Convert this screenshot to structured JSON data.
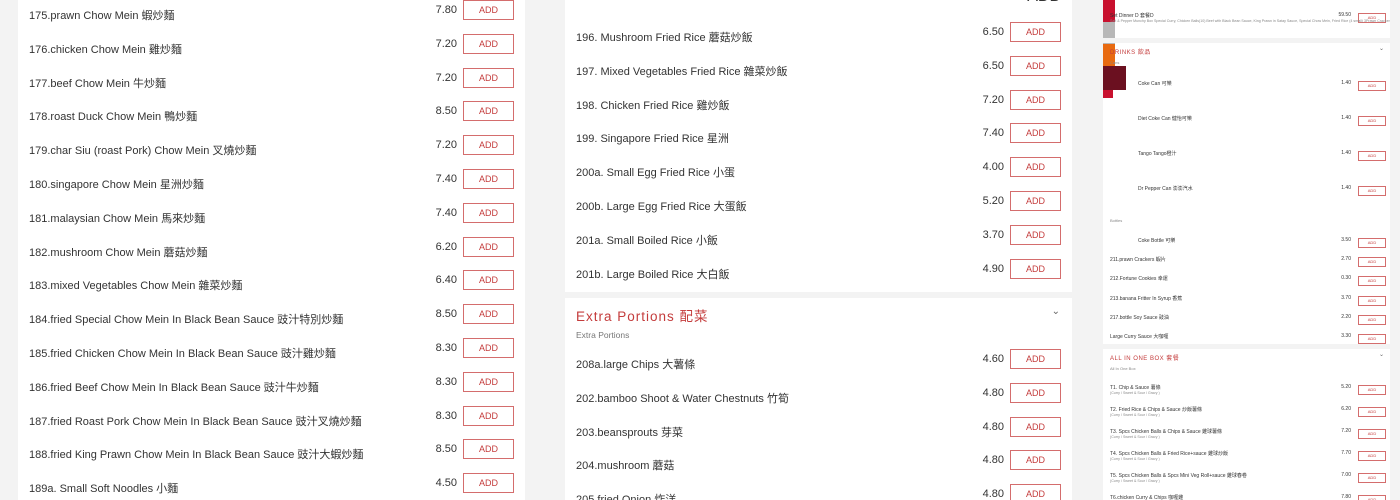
{
  "add_label": "ADD",
  "accent_color": "#c43c3c",
  "chow_mein": [
    {
      "name": "175.prawn Chow Mein 蝦炒麵",
      "price": "7.80"
    },
    {
      "name": "176.chicken Chow Mein 雞炒麵",
      "price": "7.20"
    },
    {
      "name": "177.beef Chow Mein 牛炒麵",
      "price": "7.20"
    },
    {
      "name": "178.roast Duck Chow Mein 鴨炒麵",
      "price": "8.50"
    },
    {
      "name": "179.char Siu (roast Pork) Chow Mein 叉燒炒麵",
      "price": "7.20"
    },
    {
      "name": "180.singapore Chow Mein 星洲炒麵",
      "price": "7.40"
    },
    {
      "name": "181.malaysian Chow Mein 馬來炒麵",
      "price": "7.40"
    },
    {
      "name": "182.mushroom Chow Mein 蘑菇炒麵",
      "price": "6.20"
    },
    {
      "name": "183.mixed Vegetables Chow Mein 雜菜炒麵",
      "price": "6.40"
    },
    {
      "name": "184.fried Special Chow Mein In Black Bean Sauce 豉汁特別炒麵",
      "price": "8.50"
    },
    {
      "name": "185.fried Chicken Chow Mein In Black Bean Sauce 豉汁雞炒麵",
      "price": "8.30"
    },
    {
      "name": "186.fried Beef Chow Mein In Black Bean Sauce 豉汁牛炒麵",
      "price": "8.30"
    },
    {
      "name": "187.fried Roast Pork Chow Mein In Black Bean Sauce 豉汁叉燒炒麵",
      "price": "8.30"
    },
    {
      "name": "188.fried King Prawn Chow Mein In Black Bean Sauce 豉汁大蝦炒麵",
      "price": "8.50"
    },
    {
      "name": "189a. Small Soft Noodles 小麵",
      "price": "4.50"
    }
  ],
  "fried_rice": [
    {
      "name": "196. Mushroom Fried Rice 蘑菇炒飯",
      "price": "6.50"
    },
    {
      "name": "197. Mixed Vegetables Fried Rice 雜菜炒飯",
      "price": "6.50"
    },
    {
      "name": "198. Chicken Fried Rice 雞炒飯",
      "price": "7.20"
    },
    {
      "name": "199. Singapore Fried Rice 星洲",
      "price": "7.40"
    },
    {
      "name": "200a. Small Egg Fried Rice 小蛋",
      "price": "4.00"
    },
    {
      "name": "200b. Large Egg Fried Rice 大蛋飯",
      "price": "5.20"
    },
    {
      "name": "201a. Small Boiled Rice 小飯",
      "price": "3.70"
    },
    {
      "name": "201b. Large Boiled Rice 大白飯",
      "price": "4.90"
    }
  ],
  "extra_portions": {
    "title": "Extra Portions 配菜",
    "subtitle": "Extra Portions",
    "items": [
      {
        "name": "208a.large Chips 大薯條",
        "price": "4.60"
      },
      {
        "name": "202.bamboo Shoot & Water Chestnuts 竹筍",
        "price": "4.80"
      },
      {
        "name": "203.beansprouts 芽菜",
        "price": "4.80"
      },
      {
        "name": "204.mushroom 蘑菇",
        "price": "4.80"
      },
      {
        "name": "205.fried Onion 炸洋",
        "price": "4.80"
      }
    ]
  },
  "sidebar": {
    "set_dinner": {
      "name": "Set Dinner D 套餐D",
      "price": "59.50",
      "desc": "Salt & Pepper Munchy Box Special Curry, Chicken Balls(10) Beef with Black Bean Sauce, King Prawn in Satay Sauce, Special Chow Mein, Fried Rice (4 small) 3Prawn Cracker, Bottle Pepsi"
    },
    "drinks_title": "DRINKS 飲品",
    "cans_label": "Cans",
    "cans": [
      {
        "name": "Coke Can 可樂",
        "price": "1.40",
        "color": "#c8102e"
      },
      {
        "name": "Diet Coke Can 健怡可樂",
        "price": "1.40",
        "color": "#b8b8b8"
      },
      {
        "name": "Tango Tango橙汁",
        "price": "1.40",
        "color": "#e86a10"
      },
      {
        "name": "Dr Pepper Can 澎澎汽水",
        "price": "1.40",
        "color": "#6b1020"
      }
    ],
    "bottles_label": "Bottles",
    "bottles": [
      {
        "name": "Coke Bottle 可樂",
        "price": "3.50"
      },
      {
        "name": "211.prawn Crackers 蝦片",
        "price": "2.70"
      },
      {
        "name": "212.Fortune Cookies 幸運",
        "price": "0.30"
      },
      {
        "name": "213.banana Fritter In Syrup 香蕉",
        "price": "3.70"
      },
      {
        "name": "217.bottle Soy Sauce 豉油",
        "price": "2.20"
      },
      {
        "name": "Large Curry Sauce 大咖喱",
        "price": "3.30"
      }
    ],
    "allinone_title": "ALL IN ONE BOX 套餐",
    "allinone_sub": "All In One Box",
    "allinone": [
      {
        "name": "T1. Chip & Sauce 薯條",
        "desc": "(Curry / Sweet & Sour / Gravy )",
        "price": "5.20"
      },
      {
        "name": "T2. Fried Rice & Chips & Sauce 炒飯薯條",
        "desc": "(Curry / Sweet & Sour / Gravy )",
        "price": "6.20"
      },
      {
        "name": "T3. Spcs Chicken Balls & Chips & Sauce 雞球薯條",
        "desc": "(Curry / Sweet & Sour / Gravy )",
        "price": "7.20"
      },
      {
        "name": "T4. Spcs Chicken Balls & Fried Rice+sauce 雞球炒飯",
        "desc": "(Curry / Sweet & Sour / Gravy )",
        "price": "7.70"
      },
      {
        "name": "T5. Spcs Chicken Balls & Spcs Mini Veg Roll+sauce 雞球春卷",
        "desc": "(Curry / Sweet & Sour / Gravy )",
        "price": "7.00"
      },
      {
        "name": "T6.chicken Curry & Chips 咖喱雞",
        "desc": "",
        "price": "7.80"
      }
    ]
  }
}
